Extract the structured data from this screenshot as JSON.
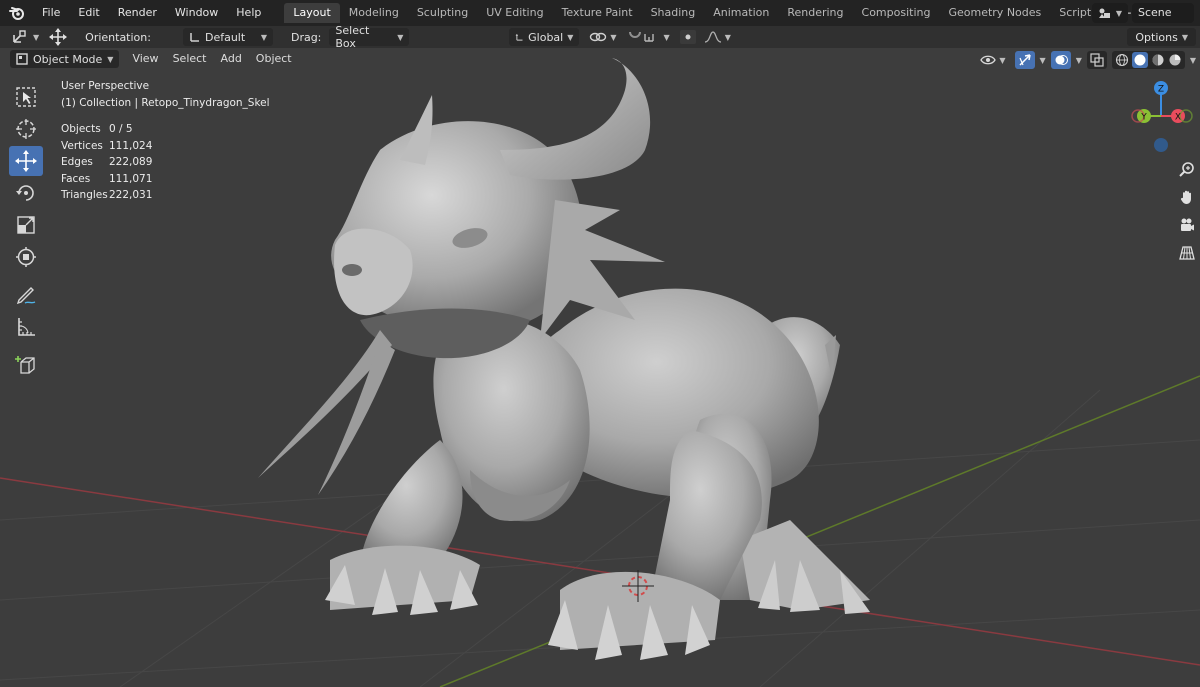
{
  "topbar": {
    "menus": [
      "File",
      "Edit",
      "Render",
      "Window",
      "Help"
    ],
    "workspaces": [
      "Layout",
      "Modeling",
      "Sculpting",
      "UV Editing",
      "Texture Paint",
      "Shading",
      "Animation",
      "Rendering",
      "Compositing",
      "Geometry Nodes",
      "Scripting"
    ],
    "active_workspace": "Layout",
    "add_workspace": "+",
    "scene_label": "Scene"
  },
  "tool_header": {
    "orientation_label": "Orientation:",
    "orientation_value": "Default",
    "drag_label": "Drag:",
    "drag_value": "Select Box",
    "transform_orientation": "Global",
    "options_label": "Options"
  },
  "viewport_header": {
    "mode": "Object Mode",
    "menus": [
      "View",
      "Select",
      "Add",
      "Object"
    ]
  },
  "overlay": {
    "view_name": "User Perspective",
    "collection": "(1) Collection | Retopo_Tinydragon_Skel",
    "stats": [
      {
        "label": "Objects",
        "value": "0 / 5"
      },
      {
        "label": "Vertices",
        "value": "111,024"
      },
      {
        "label": "Edges",
        "value": "222,089"
      },
      {
        "label": "Faces",
        "value": "111,071"
      },
      {
        "label": "Triangles",
        "value": "222,031"
      }
    ]
  },
  "toolbar": {
    "tools": [
      "select-box",
      "cursor",
      "move",
      "rotate",
      "scale",
      "transform",
      "annotate",
      "measure",
      "add-cube"
    ],
    "active_tool": "move"
  },
  "gizmo": {
    "axis_z": "Z",
    "axis_x": "X",
    "axis_y": "Y",
    "color_x": "#e94c5d",
    "color_y": "#8bc034",
    "color_z": "#3b8ee3"
  },
  "colors": {
    "accent": "#4772b3",
    "topbar": "#232323",
    "viewport": "#3d3d3d"
  }
}
